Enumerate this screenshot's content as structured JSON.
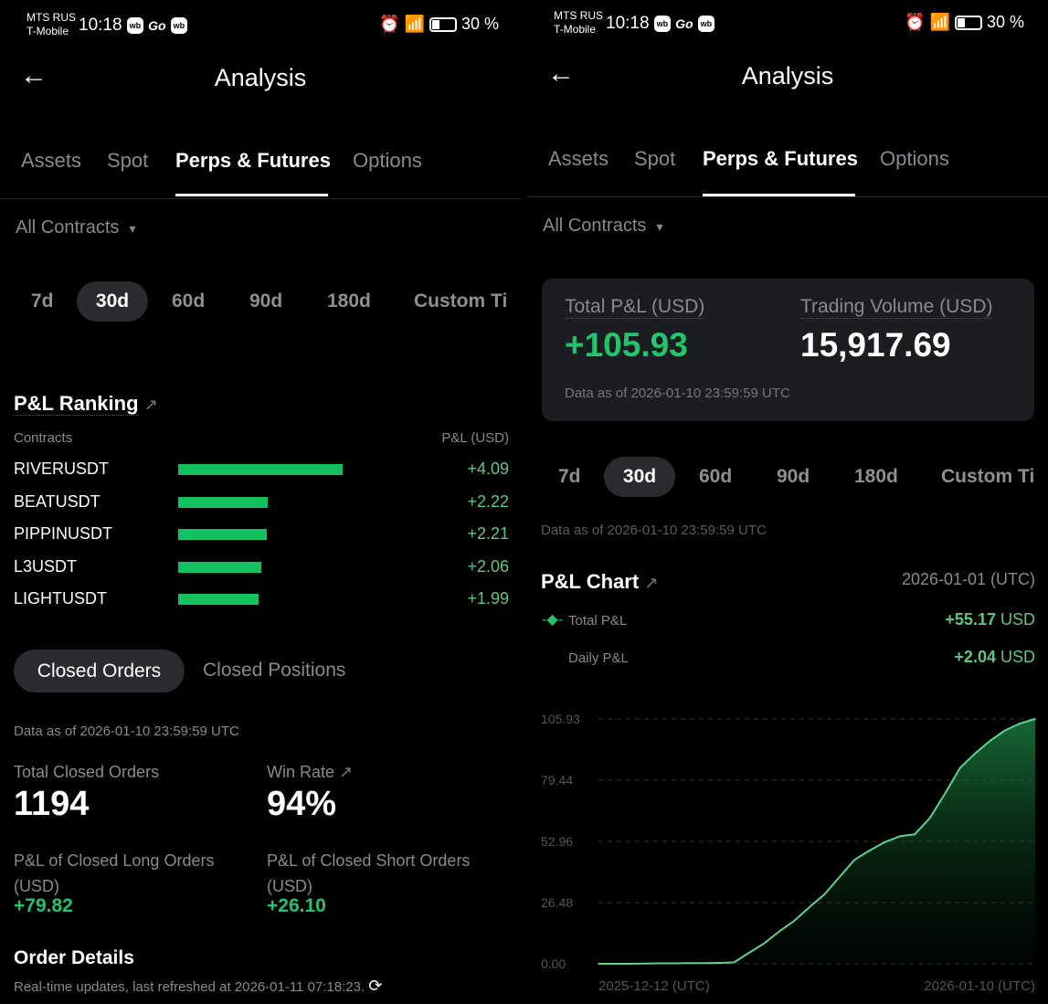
{
  "status": {
    "carrier1": "MTS RUS",
    "carrier2": "T-Mobile",
    "time": "10:18",
    "app1": "wb",
    "app2": "Go",
    "app3": "wb",
    "battery": "30 %"
  },
  "header": {
    "title": "Analysis",
    "back": "←"
  },
  "tabs": [
    "Assets",
    "Spot",
    "Perps & Futures",
    "Options"
  ],
  "filter": {
    "label": "All Contracts",
    "caret": "▾"
  },
  "periods": [
    "7d",
    "30d",
    "60d",
    "90d",
    "180d",
    "Custom Ti"
  ],
  "ranking": {
    "title": "P&L Ranking",
    "col1": "Contracts",
    "col2": "P&L (USD)",
    "max": 4.09,
    "rows": [
      {
        "name": "RIVERUSDT",
        "value": 4.09,
        "label": "+4.09"
      },
      {
        "name": "BEATUSDT",
        "value": 2.22,
        "label": "+2.22"
      },
      {
        "name": "PIPPINUSDT",
        "value": 2.21,
        "label": "+2.21"
      },
      {
        "name": "L3USDT",
        "value": 2.06,
        "label": "+2.06"
      },
      {
        "name": "LIGHTUSDT",
        "value": 1.99,
        "label": "+1.99"
      }
    ]
  },
  "orders": {
    "tab1": "Closed Orders",
    "tab2": "Closed Positions",
    "data_as_of": "Data as of 2026-01-10 23:59:59 UTC",
    "total_label": "Total Closed Orders",
    "total": "1194",
    "winrate_label": "Win Rate",
    "winrate": "94%",
    "long_label": "P&L of Closed Long Orders",
    "long_unit": "(USD)",
    "long_value": "+79.82",
    "short_label": "P&L of Closed Short Orders",
    "short_unit": "(USD)",
    "short_value": "+26.10",
    "details_title": "Order Details",
    "refresh_text": "Real-time updates, last refreshed at 2026-01-11 07:18:23."
  },
  "summary": {
    "pnl_label": "Total P&L (USD)",
    "pnl": "+105.93",
    "vol_label": "Trading Volume (USD)",
    "vol": "15,917.69",
    "data_as_of": "Data as of 2026-01-10 23:59:59 UTC"
  },
  "chart_header": {
    "data_as_of": "Data as of 2026-01-10 23:59:59 UTC",
    "title": "P&L Chart",
    "date": "2026-01-01 (UTC)",
    "total_label": "Total P&L",
    "total_value": "+55.17",
    "daily_label": "Daily P&L",
    "daily_value": "+2.04",
    "unit": "USD"
  },
  "colors": {
    "green": "#22c56c",
    "bar": "#12c25f",
    "line": "#5fd38a"
  },
  "chart_data": {
    "type": "area",
    "title": "P&L Chart",
    "xlabel": "",
    "ylabel": "",
    "x_tick_labels": [
      "2025-12-12 (UTC)",
      "2026-01-10 (UTC)"
    ],
    "y_tick_labels": [
      "105.93",
      "79.44",
      "52.96",
      "26.48",
      "0.00"
    ],
    "yticks": [
      105.93,
      79.44,
      52.96,
      26.48,
      0
    ],
    "ylim": [
      0,
      105.93
    ],
    "grid": true,
    "series": [
      {
        "name": "Total P&L",
        "x_days": [
          0,
          1,
          2,
          3,
          4,
          5,
          6,
          7,
          8,
          9,
          10,
          11,
          12,
          13,
          14,
          15,
          16,
          17,
          18,
          19,
          20,
          21,
          22,
          23,
          24,
          25,
          26,
          27,
          28,
          29
        ],
        "values": [
          0,
          0,
          0,
          0.1,
          0.2,
          0.2,
          0.3,
          0.3,
          0.4,
          0.6,
          4.8,
          8.8,
          14,
          18.6,
          24.5,
          30,
          37.5,
          45,
          49,
          52.6,
          55.17,
          56,
          63,
          73.5,
          84.7,
          91,
          96.5,
          101,
          104,
          105.93
        ]
      }
    ]
  }
}
